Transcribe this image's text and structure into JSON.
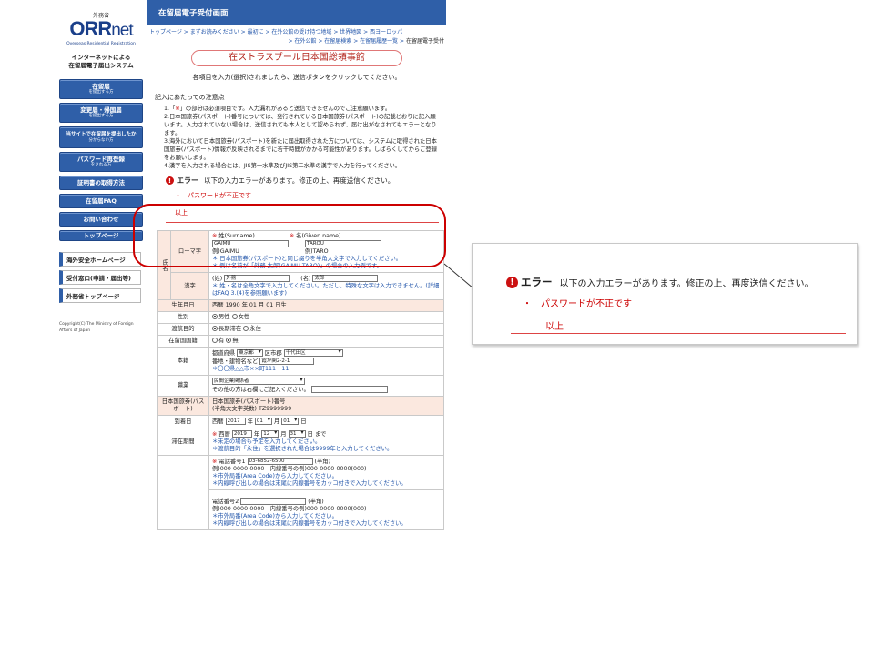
{
  "sidebar": {
    "ministry": "外務省",
    "logo_main": "ORR",
    "logo_net": "net",
    "logo_sub": "Overseas Residential Registration",
    "tagline_1": "インターネットによる",
    "tagline_2": "在留届電子届出システム",
    "nav": [
      {
        "label": "在留届",
        "sub": "を提出する方"
      },
      {
        "label": "変更届・帰国届",
        "sub": "を提出する方"
      },
      {
        "label": "当サイトで在留届を提出したか",
        "sub": "分からない方"
      },
      {
        "label": "パスワード再登録",
        "sub": "をされる方"
      },
      {
        "label": "証明書の取得方法",
        "sub": ""
      },
      {
        "label": "在留届FAQ",
        "sub": ""
      },
      {
        "label": "お問い合わせ",
        "sub": ""
      },
      {
        "label": "トップページ",
        "sub": ""
      }
    ],
    "links": [
      "海外安全ホームページ",
      "受付窓口(申請・届出等)",
      "外務省トップページ"
    ],
    "copyright": "Copyright(C) The Ministry of Foreign Affairs of Japan"
  },
  "header": {
    "title": "在留届電子受付画面"
  },
  "breadcrumb": {
    "line1": "トップページ > まずお読みください > 最初に > 在外公館の受け持つ地域 > 世界地図 > 西ヨーロッパ",
    "line2": "> 在外公館 > 在留届検索 > 在留届履歴一覧 > ",
    "current": "在留届電子受付"
  },
  "embassy": "在ストラスブール日本国総領事館",
  "instruction": "各項目を入力(選択)されましたら、送信ボタンをクリックしてください。",
  "notes_title": "記入にあたっての注意点",
  "notes": [
    {
      "pre": "1.「",
      "hl": "※",
      "post": "」の部分は必須項目です。入力漏れがあると送信できませんのでご注意願います。"
    },
    {
      "pre": "2.日本国旅券(パスポート)番号については、発行されている日本国旅券(パスポート)の記載どおりに記入願います。入力されていない場合は、送信されても本人として認められず、届け出がなされてもエラーとなります。",
      "hl": "",
      "post": ""
    },
    {
      "pre": "3.海外において日本国旅券(パスポート)を新たに届出取得された方については、システムに取得された日本国旅券(パスポート)情報が反映されるまでに若干時間がかかる可能性があります。しばらくしてからご登録をお願いします。",
      "hl": "",
      "post": ""
    },
    {
      "pre": "4.漢字を入力される場合には、JIS第一水準及びJIS第二水準の漢字で入力を行ってください。",
      "hl": "",
      "post": ""
    }
  ],
  "error": {
    "label": "エラー",
    "message": "以下の入力エラーがあります。修正の上、再度送信ください。",
    "item": "・　パスワードが不正です",
    "end": "以上"
  },
  "form": {
    "name_group": "氏名",
    "romaji_label": "ローマ字",
    "surname_label": "姓(Surname)",
    "given_label": "名(Given name)",
    "surname_value": "GAIMU",
    "given_value": "TAROU",
    "surname_example": "例)GAIMU",
    "given_example": "例)TARO",
    "romaji_hint1": "＊ 日本国旅券(パスポート)と同じ綴りを半角大文字で入力してください。",
    "romaji_hint2": "＊ 例は名前が「外務 太郎(GAIMU TARO)」の場合の入力例です。",
    "kanji_label": "漢字",
    "kanji_sei": "(姓)",
    "kanji_sei_value": "外務",
    "kanji_mei": "(名)",
    "kanji_mei_value": "太郎",
    "kanji_hint": "＊ 姓・名は全角文字で入力してください。ただし、特殊な文字は入力できません。(詳細はFAQ 3.(4)を参照願います)",
    "dob_label": "生年月日",
    "dob_value": "西暦 1990 年 01 月 01 日生",
    "sex_label": "性別",
    "sex_male": "男性",
    "sex_female": "女性",
    "purpose_label": "渡航目的",
    "purpose_long": "長期滞在",
    "purpose_perm": "永住",
    "nationality_label": "在留国国籍",
    "nat_yes": "有",
    "nat_no": "無",
    "honseki_label": "本籍",
    "pref_label": "都道府県",
    "pref_value": "東京都",
    "city_label": "区市郡",
    "city_value": "千代田区",
    "address_label": "番地・建物名など",
    "address_value": "霞が関2-2-1",
    "address_hint": "＊〇〇県△△市××町111－11",
    "job_label": "職業",
    "job_value": "民間企業関係者",
    "job_other": "その他の方は右欄にご記入ください。",
    "passport_label": "日本国旅券(パスポート)",
    "passport_line1": "日本国旅券(パスポート)番号",
    "passport_line2": "(半角大文字英数) TZ9999999",
    "arrival_label": "到着日",
    "arrival_era": "西暦",
    "arrival_year": "2017",
    "arrival_month": "01",
    "arrival_day": "01",
    "stay_label": "滞在期間",
    "stay_year": "2019",
    "stay_month": "12",
    "stay_day": "31",
    "stay_until": "日 まで",
    "stay_hint1": "＊未定の場合も予定を入力してください。",
    "stay_hint2": "＊渡航目的「永住」を選択された場合は9999年と入力してください。",
    "tel1_label": "電話番号1",
    "tel1_value": "03-6852-6500",
    "tel_halfwidth": "(半角)",
    "tel_example": "例)000-0000-0000　内線番号の例)000-0000-0000(000)",
    "tel_hint1": "＊市外局番(Area Code)から入力してください。",
    "tel_hint2": "＊内線呼び出しの場合は末尾に内線番号をカッコ付きで入力してください。",
    "tel2_label": "電話番号2"
  }
}
